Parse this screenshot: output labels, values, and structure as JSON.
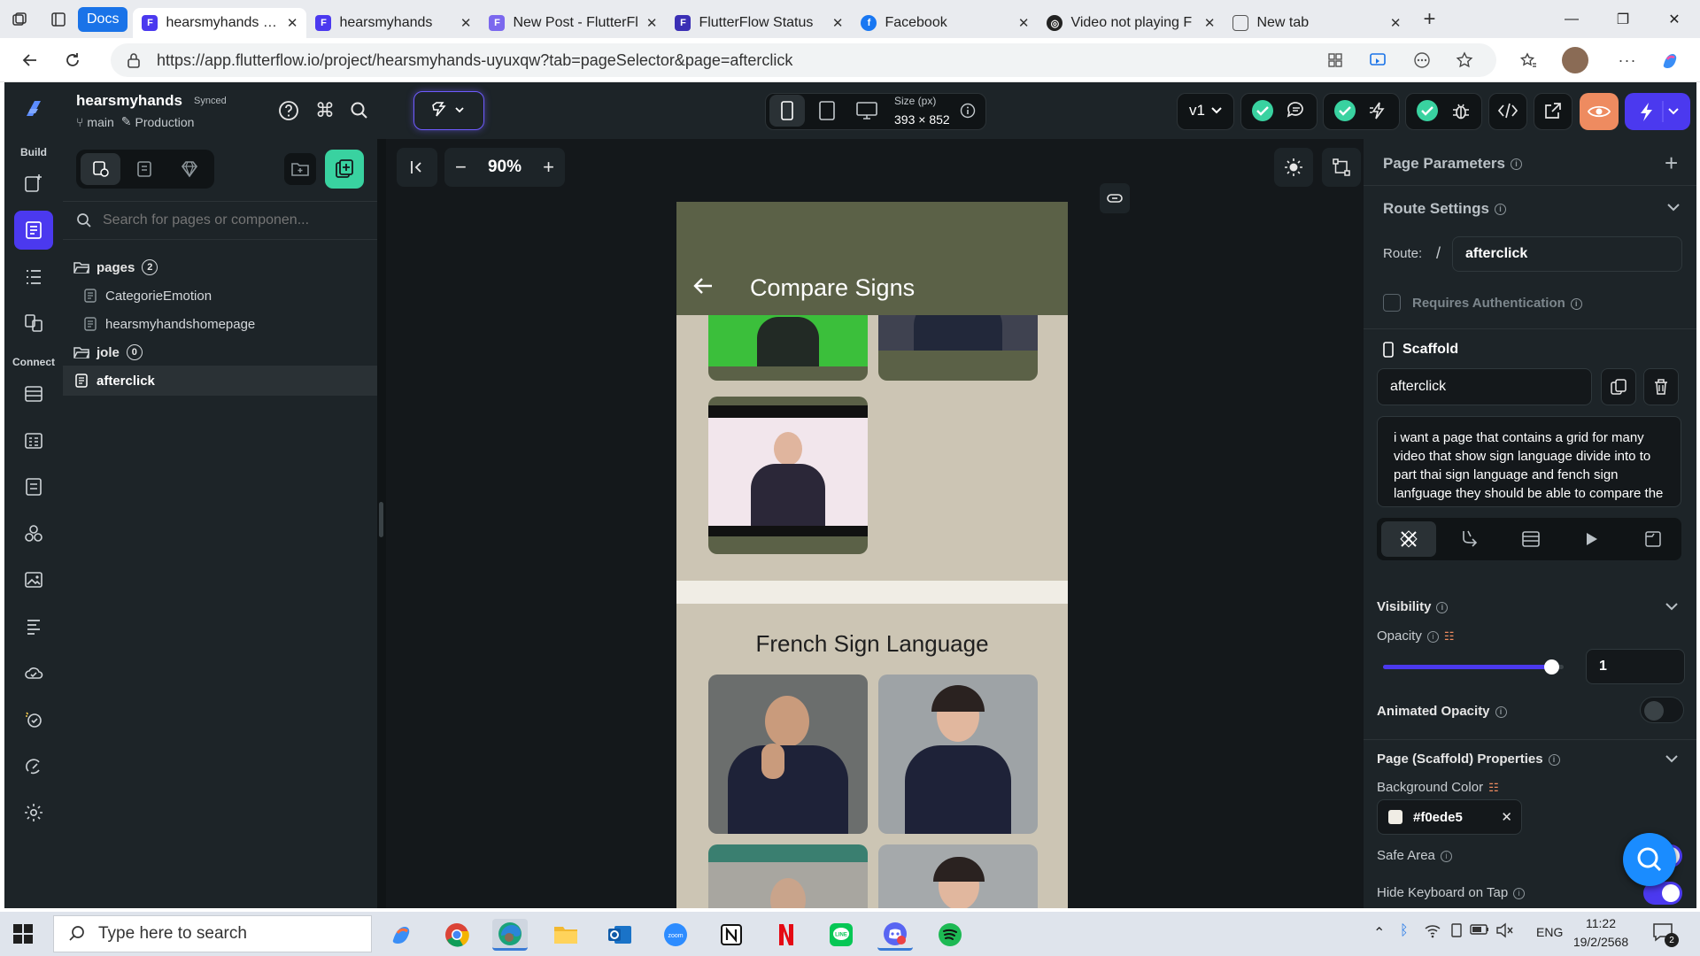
{
  "browser": {
    "docs_tab": "Docs",
    "tabs": [
      {
        "label": "hearsmyhands - Flut",
        "active": true,
        "fav": "F",
        "color": "#4b39ef"
      },
      {
        "label": "hearsmyhands",
        "active": false,
        "fav": "F",
        "color": "#4b39ef"
      },
      {
        "label": "New Post - FlutterFl",
        "active": false,
        "fav": "F",
        "color": "#7b68ee"
      },
      {
        "label": "FlutterFlow Status",
        "active": false,
        "fav": "F",
        "color": "#3b2fb5"
      },
      {
        "label": "Facebook",
        "active": false,
        "fav": "f",
        "color": "#1877f2"
      },
      {
        "label": "Video not playing F",
        "active": false,
        "fav": "O",
        "color": "#222"
      },
      {
        "label": "New tab",
        "active": false,
        "fav": "▢",
        "color": "#555"
      }
    ],
    "url": "https://app.flutterflow.io/project/hearsmyhands-uyuxqw?tab=pageSelector&page=afterclick"
  },
  "project": {
    "name": "hearsmyhands",
    "sync_status": "Synced",
    "branch": "main",
    "env": "Production"
  },
  "rail": {
    "build_label": "Build",
    "connect_label": "Connect"
  },
  "device": {
    "size_label": "Size (px)",
    "size_value": "393 × 852",
    "version": "v1"
  },
  "left_panel": {
    "search_placeholder": "Search for pages or componen...",
    "folders": [
      {
        "name": "pages",
        "count": "2",
        "items": [
          "CategorieEmotion",
          "hearsmyhandshomepage"
        ]
      },
      {
        "name": "jole",
        "count": "0",
        "items": []
      }
    ],
    "selected_page": "afterclick"
  },
  "canvas": {
    "zoom": "90%"
  },
  "phone": {
    "title": "Compare Signs",
    "section_title": "French Sign Language",
    "background": "#ccc5b4",
    "appbar_color": "#5b6147"
  },
  "right_panel": {
    "page_parameters": "Page Parameters",
    "route_settings": "Route Settings",
    "route_label": "Route:",
    "route_slash": "/",
    "route_value": "afterclick",
    "requires_auth": "Requires Authentication",
    "scaffold_title": "Scaffold",
    "scaffold_name": "afterclick",
    "description": "i want a page that contains a grid for many video that show sign language divide into to part thai sign language and fench sign lanfguage they should be able to compare the grid must be a",
    "visibility": "Visibility",
    "opacity_label": "Opacity",
    "opacity_value": "1",
    "opacity_level": 0.93,
    "animated_opacity": "Animated Opacity",
    "page_props": "Page (Scaffold) Properties",
    "bg_color_label": "Background Color",
    "bg_color_value": "#f0ede5",
    "safe_area": "Safe Area",
    "hide_keyboard": "Hide Keyboard on Tap"
  },
  "taskbar": {
    "search_placeholder": "Type here to search",
    "lang": "ENG",
    "time": "11:22",
    "date": "19/2/2568",
    "notif_count": "2"
  }
}
